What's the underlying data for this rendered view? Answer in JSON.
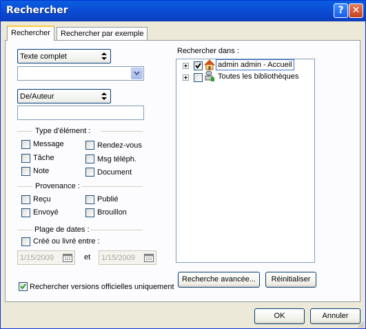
{
  "window": {
    "title": "Rechercher",
    "help_label": "?",
    "close_label": "✕"
  },
  "tabs": [
    {
      "label": "Rechercher"
    },
    {
      "label": "Rechercher par exemple"
    }
  ],
  "search_mode": {
    "value": "Texte complet"
  },
  "field_selector": {
    "value": "De/Auteur"
  },
  "search_in": {
    "label": "Rechercher dans :",
    "items": [
      {
        "label": "admin admin - Accueil",
        "checked": true
      },
      {
        "label": "Toutes les bibliothèques",
        "checked": false
      }
    ]
  },
  "item_type": {
    "label": "Type d'élément :",
    "items": [
      {
        "label": "Message"
      },
      {
        "label": "Rendez-vous"
      },
      {
        "label": "Tâche"
      },
      {
        "label": "Msg téléph."
      },
      {
        "label": "Note"
      },
      {
        "label": "Document"
      }
    ]
  },
  "origin": {
    "label": "Provenance :",
    "items": [
      {
        "label": "Reçu"
      },
      {
        "label": "Publié"
      },
      {
        "label": "Envoyé"
      },
      {
        "label": "Brouillon"
      }
    ]
  },
  "dates": {
    "label": "Plage de dates :",
    "checkbox_label": "Créé ou livré entre :",
    "from": "1/15/2009",
    "and_label": "et",
    "to": "1/15/2009"
  },
  "official_versions": {
    "label": "Rechercher versions officielles uniquement",
    "checked": true
  },
  "buttons": {
    "advanced": "Recherche avancée...",
    "reset": "Réinitialiser",
    "ok": "OK",
    "cancel": "Annuler"
  },
  "colors": {
    "titlebar": "#0a5fe0",
    "tab_highlight": "#ffc83c",
    "check": "#21a121"
  }
}
